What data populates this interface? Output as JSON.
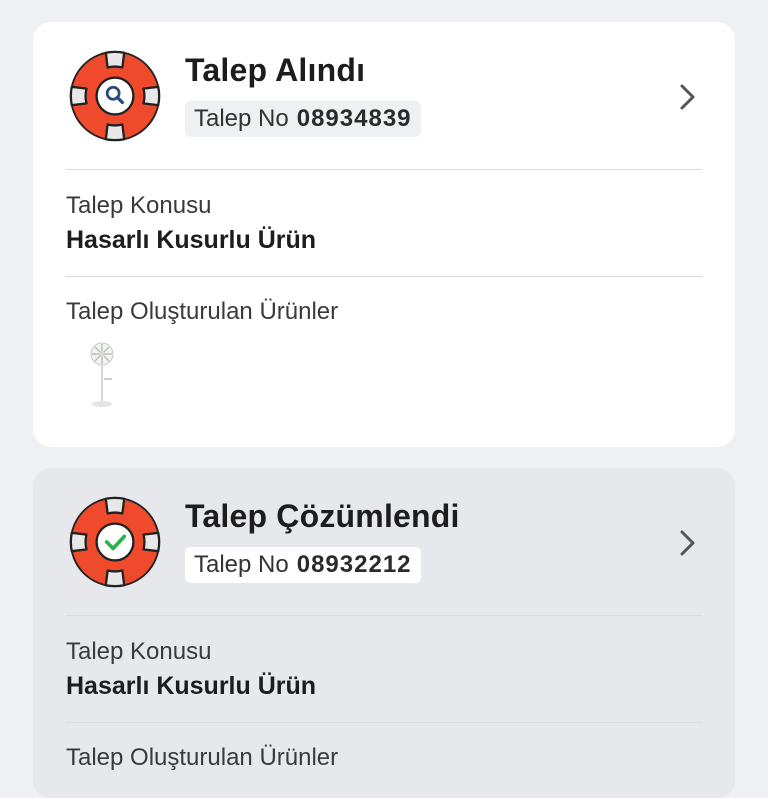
{
  "requests": [
    {
      "status_title": "Talep Alındı",
      "status_icon": "lifebuoy-search-icon",
      "request_no_label": "Talep No",
      "request_no": "08934839",
      "subject_label": "Talep Konusu",
      "subject_value": "Hasarlı Kusurlu Ürün",
      "products_label": "Talep Oluşturulan Ürünler",
      "products": [
        "standing-fan"
      ]
    },
    {
      "status_title": "Talep Çözümlendi",
      "status_icon": "lifebuoy-check-icon",
      "request_no_label": "Talep No",
      "request_no": "08932212",
      "subject_label": "Talep Konusu",
      "subject_value": "Hasarlı Kusurlu Ürün",
      "products_label": "Talep Oluşturulan Ürünler"
    }
  ],
  "colors": {
    "ring": "#ee4a2b",
    "ring_bands": "#e8e8e8",
    "search_icon": "#2a4a7a",
    "check_icon": "#2bb24c",
    "chevron": "#555555"
  }
}
